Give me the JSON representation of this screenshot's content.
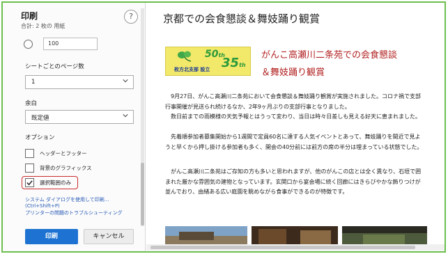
{
  "print_panel": {
    "title": "印刷",
    "subtitle": "合計: 2 枚の 用紙",
    "help_glyph": "?",
    "custom_scale_value": "100",
    "pages_per_sheet": {
      "label": "シートごとのページ数",
      "value": "1"
    },
    "margins": {
      "label": "余白",
      "value": "既定値"
    },
    "options": {
      "label": "オプション",
      "items": [
        {
          "label": "ヘッダーとフッター",
          "checked": false
        },
        {
          "label": "背景のグラフィックス",
          "checked": false
        },
        {
          "label": "選択範囲のみ",
          "checked": true
        }
      ]
    },
    "links": {
      "system_dialog": "システム ダイアログを使用して印刷... (Ctrl+Shift+P)",
      "troubleshoot": "プリンターの問題のトラブルシューティング"
    },
    "print_button": "印刷",
    "cancel_button": "キャンセル",
    "accent_color": "#1e73d2",
    "highlight_color": "#cc2a2a"
  },
  "preview": {
    "doc_title": "京都での会食懇談＆舞妓踊り観賞",
    "logo": {
      "num_50": "50",
      "sup_50": "th",
      "num_35": "35",
      "sup_35": "th",
      "subtitle": "枚方北支部 設立"
    },
    "heading_line1": "がんこ高瀬川二条苑での会食懇談",
    "heading_line2": "＆舞妓踊り観賞",
    "heading_color": "#b22222",
    "paragraphs": [
      "9月27日、がんこ高瀬川二条苑において会食懇談＆舞妓踊り観賞が実施されました。コロナ禍で支部行事開催が見送られ続けるなか、2年9ヶ月ぶりの支部行事となりました。",
      "数日前までの雨模様の天気予報とはうって変わり、当日は時々日差しも見える好天に恵まれました。",
      "先着順参加者募集開始から1週間で定員60名に達する人気イベントとあって、舞妓踊りを間近で見ようと早くから押し掛ける参加者も多く、開会の40分前には前方の席の半分は埋まっている状態でした。",
      "がんこ高瀬川二条苑はご存知の方も多いと思われますが、他のがんこの店とは全く異なり、石垣で囲まれた厳かな雰囲気の建物となっています。玄関口から宴会場に続く回廊にはきらびやかな飾りつけが並んでおり、由緒ある広い庭園を眺めながら食事ができるのが特徴です。"
    ]
  }
}
